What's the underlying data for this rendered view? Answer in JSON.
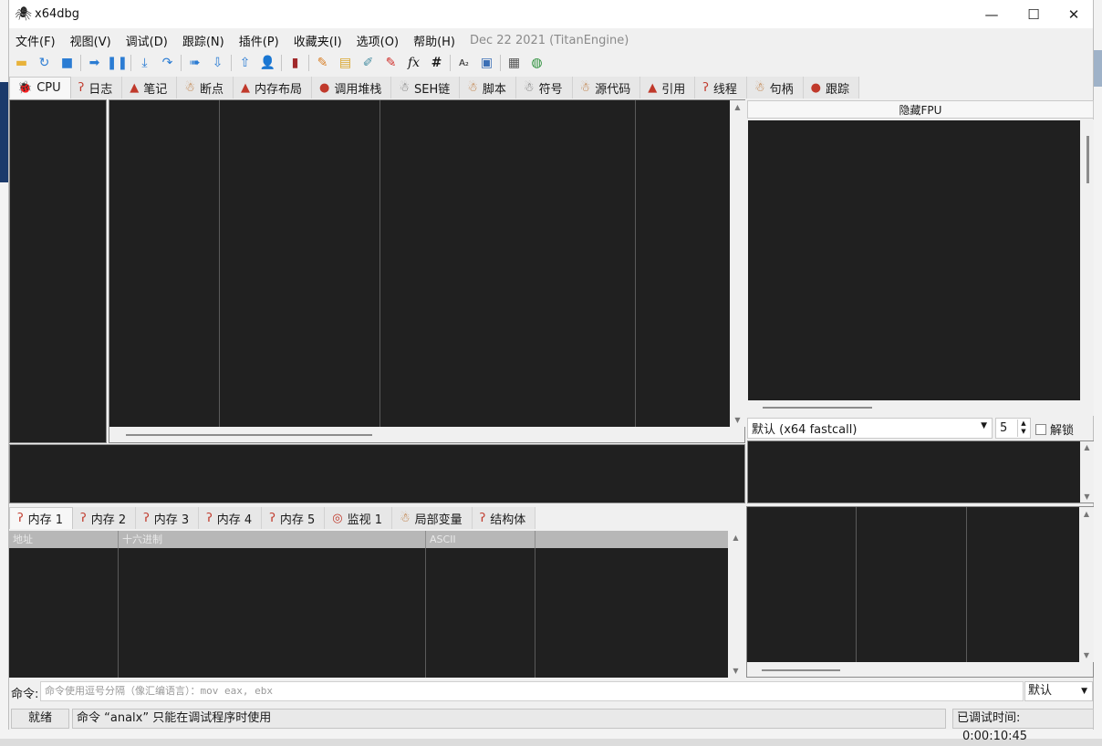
{
  "window": {
    "title": "x64dbg",
    "buttons": {
      "minimize": "—",
      "maximize": "☐",
      "close": "✕"
    }
  },
  "menu": {
    "items": [
      "文件(F)",
      "视图(V)",
      "调试(D)",
      "跟踪(N)",
      "插件(P)",
      "收藏夹(I)",
      "选项(O)",
      "帮助(H)"
    ],
    "build_info": "Dec 22 2021 (TitanEngine)"
  },
  "toolbar": {
    "icons": [
      "open-icon",
      "restart-icon",
      "stop-icon",
      "run-icon",
      "pause-icon",
      "step-into-icon",
      "step-over-icon",
      "trace-into-icon",
      "trace-over-icon",
      "execute-till-return-icon",
      "run-to-user-code-icon",
      "scylla-icon",
      "patch-icon",
      "comments-icon",
      "labels-icon",
      "bookmarks-icon",
      "functions-icon",
      "hash-icon",
      "strings-icon",
      "analyze-icon",
      "calculator-icon",
      "web-icon"
    ]
  },
  "main_tabs": [
    {
      "label": "CPU",
      "icon": "bug-icon"
    },
    {
      "label": "日志",
      "icon": "candy-cane-icon"
    },
    {
      "label": "笔记",
      "icon": "santa-hat-icon"
    },
    {
      "label": "断点",
      "icon": "gingerbread-icon"
    },
    {
      "label": "内存布局",
      "icon": "santa-hat-icon"
    },
    {
      "label": "调用堆栈",
      "icon": "stop-badge-icon"
    },
    {
      "label": "SEH链",
      "icon": "snowman-icon"
    },
    {
      "label": "脚本",
      "icon": "gingerbread-icon"
    },
    {
      "label": "符号",
      "icon": "snowman-icon"
    },
    {
      "label": "源代码",
      "icon": "gingerbread-icon"
    },
    {
      "label": "引用",
      "icon": "santa-hat-icon"
    },
    {
      "label": "线程",
      "icon": "candy-cane-icon"
    },
    {
      "label": "句柄",
      "icon": "gingerbread-icon"
    },
    {
      "label": "跟踪",
      "icon": "stop-badge-icon"
    }
  ],
  "registers": {
    "hide_fpu_label": "隐藏FPU",
    "call_convention": "默认 (x64 fastcall)",
    "arg_count": "5",
    "unlock_label": "解锁"
  },
  "memory_tabs": [
    {
      "label": "内存 1",
      "icon": "candy-cane-icon"
    },
    {
      "label": "内存 2",
      "icon": "candy-cane-icon"
    },
    {
      "label": "内存 3",
      "icon": "candy-cane-icon"
    },
    {
      "label": "内存 4",
      "icon": "candy-cane-icon"
    },
    {
      "label": "内存 5",
      "icon": "candy-cane-icon"
    },
    {
      "label": "监视 1",
      "icon": "lollipop-icon"
    },
    {
      "label": "局部变量",
      "icon": "gingerbread-icon"
    },
    {
      "label": "结构体",
      "icon": "candy-cane-icon"
    }
  ],
  "dump_columns": [
    "地址",
    "十六进制",
    "ASCII",
    ""
  ],
  "command": {
    "label": "命令:",
    "placeholder": "命令使用逗号分隔（像汇编语言）：mov eax, ebx",
    "mode": "默认"
  },
  "status": {
    "state": "就绪",
    "message": "命令 “analx” 只能在调试程序时使用",
    "time_label": "已调试时间:",
    "time_value": "0:00:10:45"
  },
  "colors": {
    "panel_dark": "#202020",
    "window_bg": "#f0f0f0",
    "santa_red": "#c0392b",
    "gingerbread": "#b5651d"
  }
}
